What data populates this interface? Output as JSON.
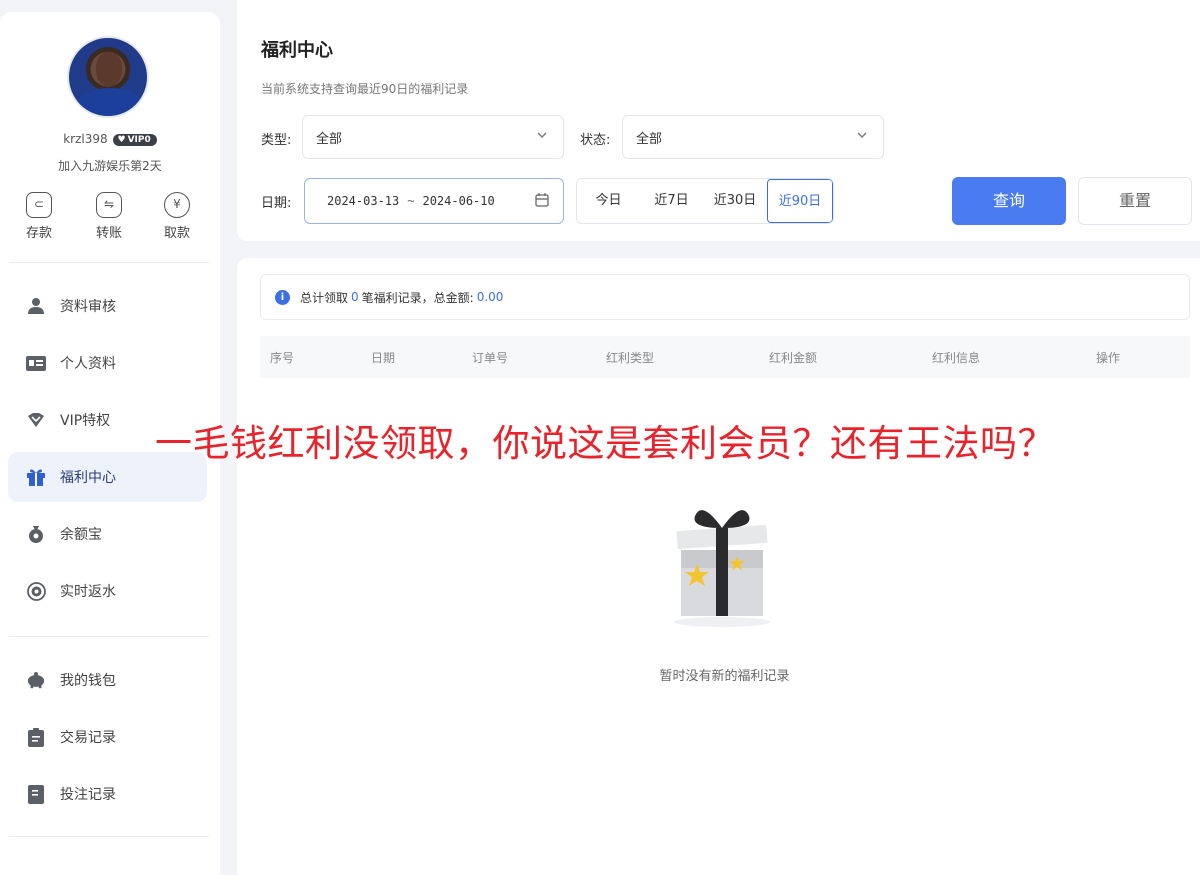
{
  "profile": {
    "username": "krzl398",
    "vip": "VIP0",
    "join_text": "加入九游娱乐第2天"
  },
  "quick_actions": [
    {
      "label": "存款",
      "icon": "deposit-icon"
    },
    {
      "label": "转账",
      "icon": "transfer-icon"
    },
    {
      "label": "取款",
      "icon": "withdraw-icon"
    }
  ],
  "nav": {
    "items": [
      {
        "label": "资料审核",
        "icon": "user-verify-icon"
      },
      {
        "label": "个人资料",
        "icon": "id-card-icon"
      },
      {
        "label": "VIP特权",
        "icon": "vip-heart-icon"
      },
      {
        "label": "福利中心",
        "icon": "gift-icon"
      },
      {
        "label": "余额宝",
        "icon": "money-bag-icon"
      },
      {
        "label": "实时返水",
        "icon": "rebate-icon"
      },
      {
        "label": "我的钱包",
        "icon": "piggy-bank-icon"
      },
      {
        "label": "交易记录",
        "icon": "clipboard-icon"
      },
      {
        "label": "投注记录",
        "icon": "bet-record-icon"
      }
    ]
  },
  "header": {
    "title": "福利中心",
    "subtitle": "当前系统支持查询最近90日的福利记录"
  },
  "filters": {
    "type_label": "类型:",
    "type_value": "全部",
    "status_label": "状态:",
    "status_value": "全部",
    "date_label": "日期:",
    "date_start": "2024-03-13",
    "date_sep": "~",
    "date_end": "2024-06-10",
    "quick_dates": [
      "今日",
      "近7日",
      "近30日",
      "近90日"
    ],
    "query_label": "查询",
    "reset_label": "重置"
  },
  "summary": {
    "prefix": "总计领取",
    "count": "0",
    "middle": "笔福利记录，总金额:",
    "amount": "0.00"
  },
  "table": {
    "columns": [
      "序号",
      "日期",
      "订单号",
      "红利类型",
      "红利金额",
      "红利信息",
      "操作"
    ]
  },
  "empty_text": "暂时没有新的福利记录",
  "overlay_caption": "一毛钱红利没领取，你说这是套利会员？还有王法吗？",
  "colors": {
    "accent": "#4a7bf0",
    "caption": "#e8232b"
  }
}
